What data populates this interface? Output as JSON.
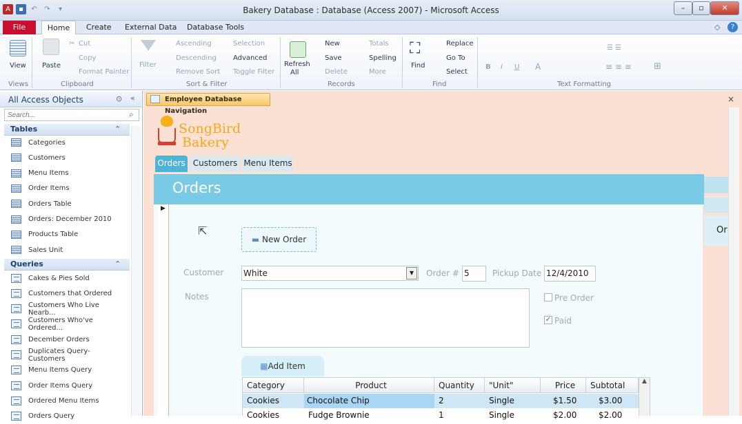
{
  "window": {
    "title": "Bakery Database : Database (Access 2007)  -  Microsoft Access"
  },
  "ribbon": {
    "tabs": [
      "File",
      "Home",
      "Create",
      "External Data",
      "Database Tools"
    ],
    "groups": {
      "views": {
        "label": "Views",
        "view": "View"
      },
      "clipboard": {
        "label": "Clipboard",
        "paste": "Paste",
        "cut": "Cut",
        "copy": "Copy",
        "format_painter": "Format Painter"
      },
      "sort_filter": {
        "label": "Sort & Filter",
        "filter": "Filter",
        "ascending": "Ascending",
        "descending": "Descending",
        "remove_sort": "Remove Sort",
        "selection": "Selection",
        "advanced": "Advanced",
        "toggle_filter": "Toggle Filter"
      },
      "records": {
        "label": "Records",
        "refresh": "Refresh",
        "refresh2": "All",
        "new": "New",
        "save": "Save",
        "delete": "Delete",
        "totals": "Totals",
        "spelling": "Spelling",
        "more": "More"
      },
      "find": {
        "label": "Find",
        "find": "Find",
        "replace": "Replace",
        "goto": "Go To",
        "select": "Select"
      },
      "text_formatting": {
        "label": "Text Formatting"
      }
    }
  },
  "nav": {
    "header": "All Access Objects",
    "search_placeholder": "Search...",
    "tables_label": "Tables",
    "tables": [
      "Categories",
      "Customers",
      "Menu Items",
      "Order Items",
      "Orders Table",
      "Orders: December 2010",
      "Products Table",
      "Sales Unit"
    ],
    "queries_label": "Queries",
    "queries": [
      "Cakes & Pies Sold",
      "Customers that Ordered",
      "Customers Who Live Nearb...",
      "Customers Who've Ordered...",
      "December Orders",
      "Duplicates Query- Customers",
      "Menu Items Query",
      "Order Items Query",
      "Ordered Menu Items",
      "Orders Query"
    ]
  },
  "document": {
    "tab": "Employee Database Navigation",
    "logo_line1": "SongBird",
    "logo_line2": "Bakery",
    "nav_tabs": [
      "Orders",
      "Customers",
      "Menu Items"
    ],
    "side_tab": "Or",
    "form_title": "Orders",
    "new_order": "New Order",
    "customer_label": "Customer",
    "customer_value": "White",
    "order_no_label": "Order #",
    "order_no_value": "5",
    "pickup_label": "Pickup Date",
    "pickup_value": "12/4/2010",
    "notes_label": "Notes",
    "pre_order_label": "Pre Order",
    "paid_label": "Paid",
    "add_item": "Add Item",
    "grid_headers": [
      "Category",
      "Product",
      "Quantity",
      "\"Unit\"",
      "Price",
      "Subtotal"
    ],
    "rows": [
      [
        "Cookies",
        "Chocolate Chip",
        "2",
        "Single",
        "$1.50",
        "$3.00"
      ],
      [
        "Cookies",
        "Fudge Brownie",
        "1",
        "Single",
        "$2.00",
        "$2.00"
      ]
    ]
  },
  "colors": {
    "file_tab": "#c8102e",
    "orders_band": "#79cbe5",
    "doc_bg": "#fbe1d3"
  }
}
